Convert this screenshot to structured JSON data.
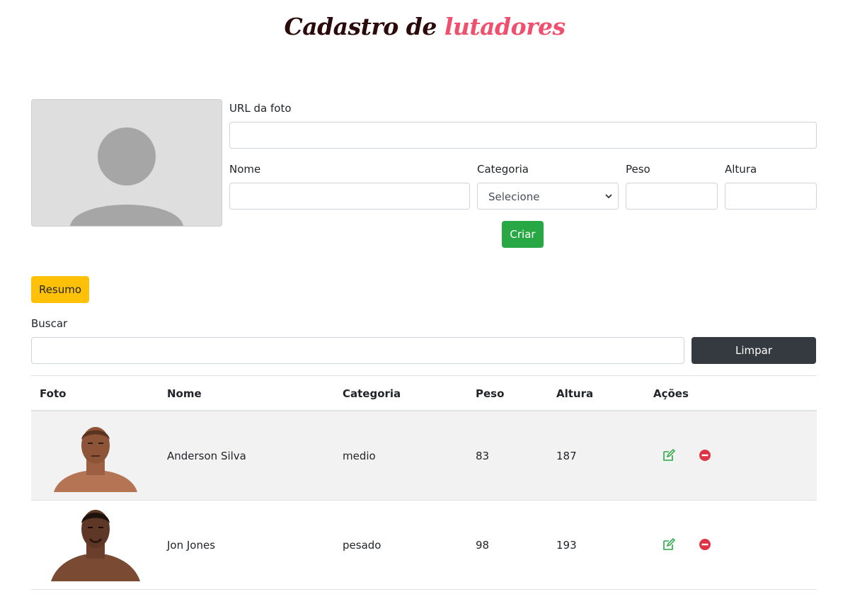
{
  "header": {
    "title_part1": "Cadastro de",
    "title_part2": "lutadores"
  },
  "form": {
    "photo_url_label": "URL da foto",
    "photo_url_value": "",
    "name_label": "Nome",
    "name_value": "",
    "category_label": "Categoria",
    "category_selected": "Selecione",
    "weight_label": "Peso",
    "weight_value": "",
    "height_label": "Altura",
    "height_value": "",
    "create_button": "Criar"
  },
  "summary_button": "Resumo",
  "search": {
    "label": "Buscar",
    "value": "",
    "clear_button": "Limpar"
  },
  "table": {
    "headers": [
      "Foto",
      "Nome",
      "Categoria",
      "Peso",
      "Altura",
      "Ações"
    ],
    "rows": [
      {
        "name": "Anderson Silva",
        "category": "medio",
        "weight": "83",
        "height": "187",
        "photo_icon": "fighter-photo"
      },
      {
        "name": "Jon Jones",
        "category": "pesado",
        "weight": "98",
        "height": "193",
        "photo_icon": "fighter-photo"
      }
    ]
  },
  "colors": {
    "title_dark": "#2a0a0a",
    "title_accent": "#f0506e",
    "success": "#28a745",
    "warning": "#ffc107",
    "dark": "#343a40",
    "danger": "#dc3545"
  }
}
